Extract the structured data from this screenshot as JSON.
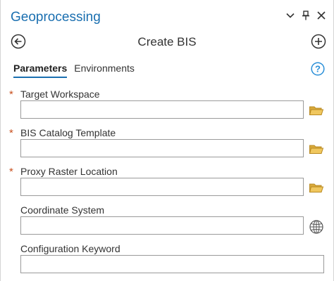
{
  "pane": {
    "title": "Geoprocessing",
    "controls": {
      "options_icon": "chevron-down-icon",
      "pin_icon": "pin-icon",
      "close_icon": "close-icon"
    }
  },
  "tool": {
    "title": "Create BIS",
    "back_icon": "back-arrow-icon",
    "add_icon": "add-circle-icon"
  },
  "tabs": [
    {
      "label": "Parameters",
      "active": true
    },
    {
      "label": "Environments",
      "active": false
    }
  ],
  "help_icon": "help-icon",
  "parameters": [
    {
      "label": "Target Workspace",
      "required": true,
      "value": "",
      "icon": "folder-icon"
    },
    {
      "label": "BIS Catalog Template",
      "required": true,
      "value": "",
      "icon": "folder-icon"
    },
    {
      "label": "Proxy Raster Location",
      "required": true,
      "value": "",
      "icon": "folder-icon"
    },
    {
      "label": "Coordinate System",
      "required": false,
      "value": "",
      "icon": "globe-icon"
    },
    {
      "label": "Configuration Keyword",
      "required": false,
      "value": "",
      "icon": ""
    }
  ],
  "required_marker": "*",
  "colors": {
    "accent": "#1a6fb0",
    "required": "#c8501e",
    "folder": "#e2b344"
  }
}
